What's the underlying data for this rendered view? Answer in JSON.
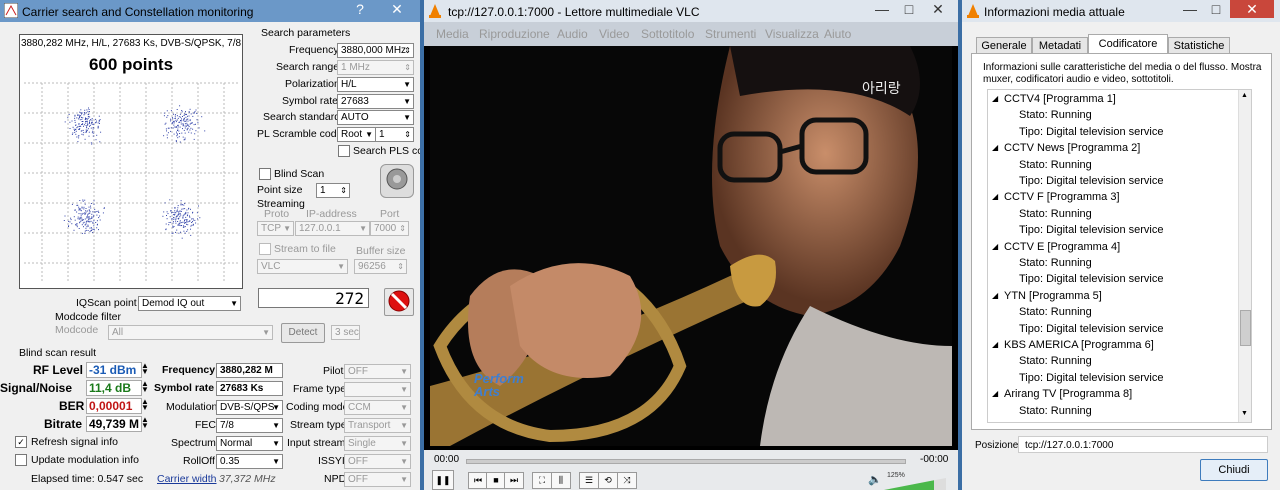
{
  "sat": {
    "title": "Carrier search and Constellation monitoring",
    "help": "?",
    "close": "✕",
    "info_line": "3880,282 MHz, H/L, 27683 Ks, DVB-S/QPSK, 7/8",
    "points_label": "600 points",
    "search_params_header": "Search parameters",
    "frequency_label": "Frequency",
    "frequency_value": "3880,000 MHz",
    "search_range_label": "Search range",
    "search_range_value": "1 MHz",
    "polarization_label": "Polarization",
    "polarization_value": "H/L",
    "symbol_rate_label": "Symbol rate",
    "symbol_rate_value": "27683",
    "search_standard_label": "Search standard",
    "search_standard_value": "AUTO",
    "pl_scramble_label": "PL Scramble code",
    "pl_scramble_value": "Root",
    "pl_scramble_num": "1",
    "search_pls_label": "Search PLS cc",
    "blind_scan_label": "Blind Scan",
    "point_size_label": "Point size",
    "point_size_value": "1",
    "streaming_label": "Streaming",
    "proto_label": "Proto",
    "ip_label": "IP-address",
    "port_label": "Port",
    "proto_value": "TCP",
    "ip_value": "127.0.0.1",
    "port_value": "7000",
    "stream_to_file_label": "Stream to file",
    "buffer_size_label": "Buffer size",
    "stream_target_value": "VLC",
    "buffer_size_value": "96256",
    "counter": "272",
    "iqscan_label": "IQScan point",
    "iqscan_value": "Demod IQ out",
    "modcode_filter_label": "Modcode filter",
    "modcode_label": "Modcode",
    "modcode_value": "All",
    "detect_label": "Detect",
    "detect_time": "3 sec",
    "blind_result_label": "Blind scan result",
    "rf_level_label": "RF Level",
    "rf_level_value": "-31 dBm",
    "signal_noise_label": "Signal/Noise",
    "signal_noise_value": "11,4 dB",
    "ber_label": "BER",
    "ber_value": "0,00001",
    "bitrate_label": "Bitrate",
    "bitrate_value": "49,739 M",
    "freq_res_label": "Frequency",
    "freq_res_value": "3880,282 M",
    "symrate_res_label": "Symbol rate",
    "symrate_res_value": "27683 Ks",
    "modulation_label": "Modulation",
    "modulation_value": "DVB-S/QPS",
    "fec_label": "FEC",
    "fec_value": "7/8",
    "spectrum_label": "Spectrum",
    "spectrum_value": "Normal",
    "rolloff_label": "RollOff",
    "rolloff_value": "0.35",
    "carrier_width_label": "Carrier width",
    "carrier_width_value": "37,372 MHz",
    "pilot_label": "Pilot",
    "pilot_value": "OFF",
    "frame_type_label": "Frame type",
    "coding_mode_label": "Coding mode",
    "coding_mode_value": "CCM",
    "stream_type_label": "Stream type",
    "stream_type_value": "Transport",
    "input_stream_label": "Input stream",
    "input_stream_value": "Single",
    "issyi_label": "ISSYI",
    "issyi_value": "OFF",
    "npd_label": "NPD",
    "npd_value": "OFF",
    "refresh_label": "Refresh signal info",
    "update_mod_label": "Update modulation info",
    "elapsed_label": "Elapsed time: 0.547 sec"
  },
  "vlc": {
    "title": "tcp://127.0.0.1:7000 - Lettore multimediale VLC",
    "menu": [
      "Media",
      "Riproduzione",
      "Audio",
      "Video",
      "Sottotitolo",
      "Strumenti",
      "Visualizza",
      "Aiuto"
    ],
    "channel_logo": "아리랑",
    "watermark_1": "Perform",
    "watermark_2": "Arts",
    "time_elapsed": "00:00",
    "time_remaining": "-00:00",
    "volume": "125%"
  },
  "info": {
    "title": "Informazioni media attuale",
    "tabs": [
      "Generale",
      "Metadati",
      "Codificatore",
      "Statistiche"
    ],
    "description": "Informazioni sulle caratteristiche del media o del flusso. Mostra muxer, codificatori audio e video, sottotitoli.",
    "tree": [
      {
        "name": "CCTV4 [Programma 1]",
        "stato": "Stato: Running",
        "tipo": "Tipo: Digital television service"
      },
      {
        "name": "CCTV News [Programma 2]",
        "stato": "Stato: Running",
        "tipo": "Tipo: Digital television service"
      },
      {
        "name": "CCTV F [Programma 3]",
        "stato": "Stato: Running",
        "tipo": "Tipo: Digital television service"
      },
      {
        "name": "CCTV E [Programma 4]",
        "stato": "Stato: Running",
        "tipo": "Tipo: Digital television service"
      },
      {
        "name": "YTN [Programma 5]",
        "stato": "Stato: Running",
        "tipo": "Tipo: Digital television service"
      },
      {
        "name": "KBS AMERICA [Programma 6]",
        "stato": "Stato: Running",
        "tipo": "Tipo: Digital television service"
      },
      {
        "name": "Arirang TV [Programma 8]",
        "stato": "Stato: Running",
        "tipo": ""
      }
    ],
    "position_label": "Posizione:",
    "position_value": "tcp://127.0.0.1:7000",
    "close_button": "Chiudi"
  }
}
